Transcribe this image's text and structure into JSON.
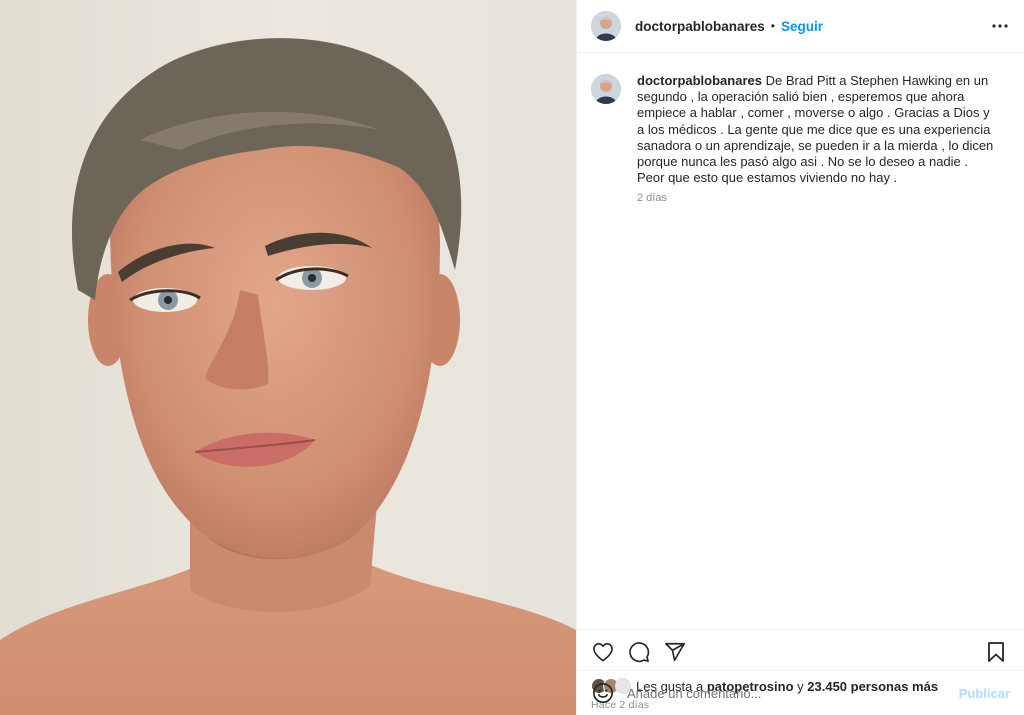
{
  "post": {
    "author": {
      "username": "doctorpablobanares",
      "follow_label": "Seguir",
      "separator": "•"
    },
    "media": {
      "type": "photo",
      "subject": "selfie-portrait"
    },
    "caption": {
      "username": "doctorpablobanares",
      "text": "De Brad Pitt a Stephen Hawking en un segundo , la operación salió bien , esperemos que ahora empiece a hablar , comer , moverse o algo . Gracias a Dios y a los médicos . La gente que me dice que es una experiencia sanadora o un aprendizaje, se pueden ir a la mierda , lo dicen porque nunca les pasó algo asi . No se lo deseo a nadie . Peor que esto que estamos viviendo no hay .",
      "time": "2 días"
    },
    "actions": {
      "like_icon": "heart-icon",
      "comment_icon": "comment-bubble-icon",
      "share_icon": "paper-plane-icon",
      "save_icon": "bookmark-icon"
    },
    "likes": {
      "prefix": "Les gusta a",
      "user": "patopetrosino",
      "connector": "y",
      "others": "23.450 personas más"
    },
    "time_ago": "Hace 2 días",
    "comment_box": {
      "placeholder": "Añade un comentario...",
      "publish_label": "Publicar"
    }
  },
  "colors": {
    "link_blue": "#0095f6",
    "publish_disabled": "#b3dbff",
    "border": "#efefef",
    "muted_text": "#8e8e8e"
  }
}
